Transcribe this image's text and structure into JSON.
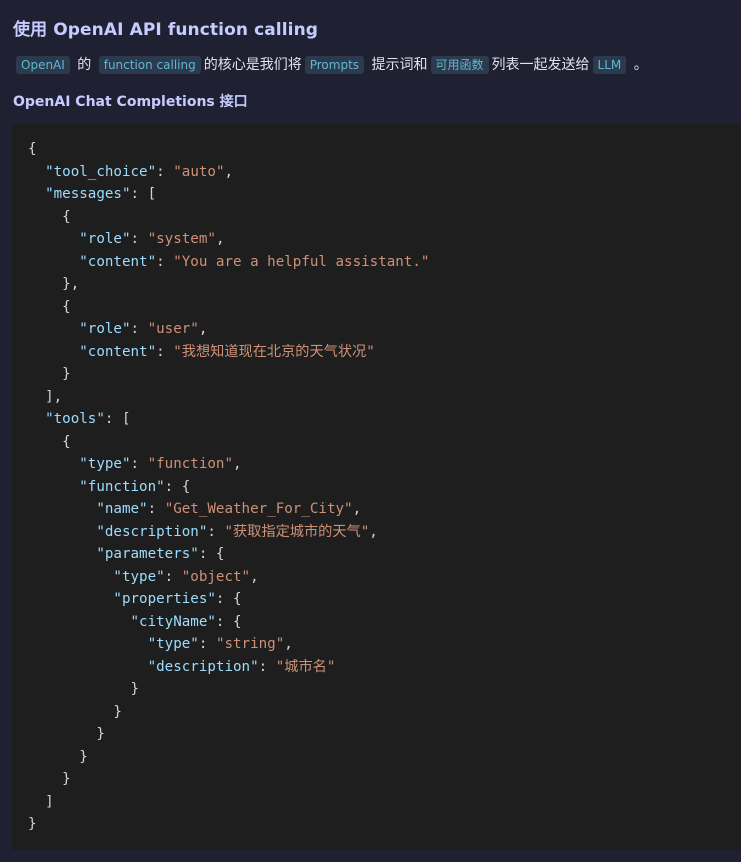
{
  "heading": "使用 OpenAI API function calling",
  "paragraph": {
    "segments": [
      {
        "type": "code",
        "text": "OpenAI"
      },
      {
        "type": "text",
        "text": " 的 "
      },
      {
        "type": "code",
        "text": "function calling"
      },
      {
        "type": "text",
        "text": "的核心是我们将"
      },
      {
        "type": "code",
        "text": "Prompts"
      },
      {
        "type": "text",
        "text": " 提示词和"
      },
      {
        "type": "code",
        "text": "可用函数"
      },
      {
        "type": "text",
        "text": "列表一起发送给"
      },
      {
        "type": "code",
        "text": "LLM"
      },
      {
        "type": "text",
        "text": " 。"
      }
    ]
  },
  "subheading": "OpenAI Chat Completions 接口",
  "code": {
    "language": "json",
    "colors": {
      "key": "#9cdcfe",
      "string": "#ce9178",
      "punct": "#d4d4d4",
      "background": "#1e1e1e"
    },
    "lines": [
      "{",
      "  \"tool_choice\": \"auto\",",
      "  \"messages\": [",
      "    {",
      "      \"role\": \"system\",",
      "      \"content\": \"You are a helpful assistant.\"",
      "    },",
      "    {",
      "      \"role\": \"user\",",
      "      \"content\": \"我想知道现在北京的天气状况\"",
      "    }",
      "  ],",
      "  \"tools\": [",
      "    {",
      "      \"type\": \"function\",",
      "      \"function\": {",
      "        \"name\": \"Get_Weather_For_City\",",
      "        \"description\": \"获取指定城市的天气\",",
      "        \"parameters\": {",
      "          \"type\": \"object\",",
      "          \"properties\": {",
      "            \"cityName\": {",
      "              \"type\": \"string\",",
      "              \"description\": \"城市名\"",
      "            }",
      "          }",
      "        }",
      "      }",
      "    }",
      "  ]",
      "}"
    ]
  }
}
